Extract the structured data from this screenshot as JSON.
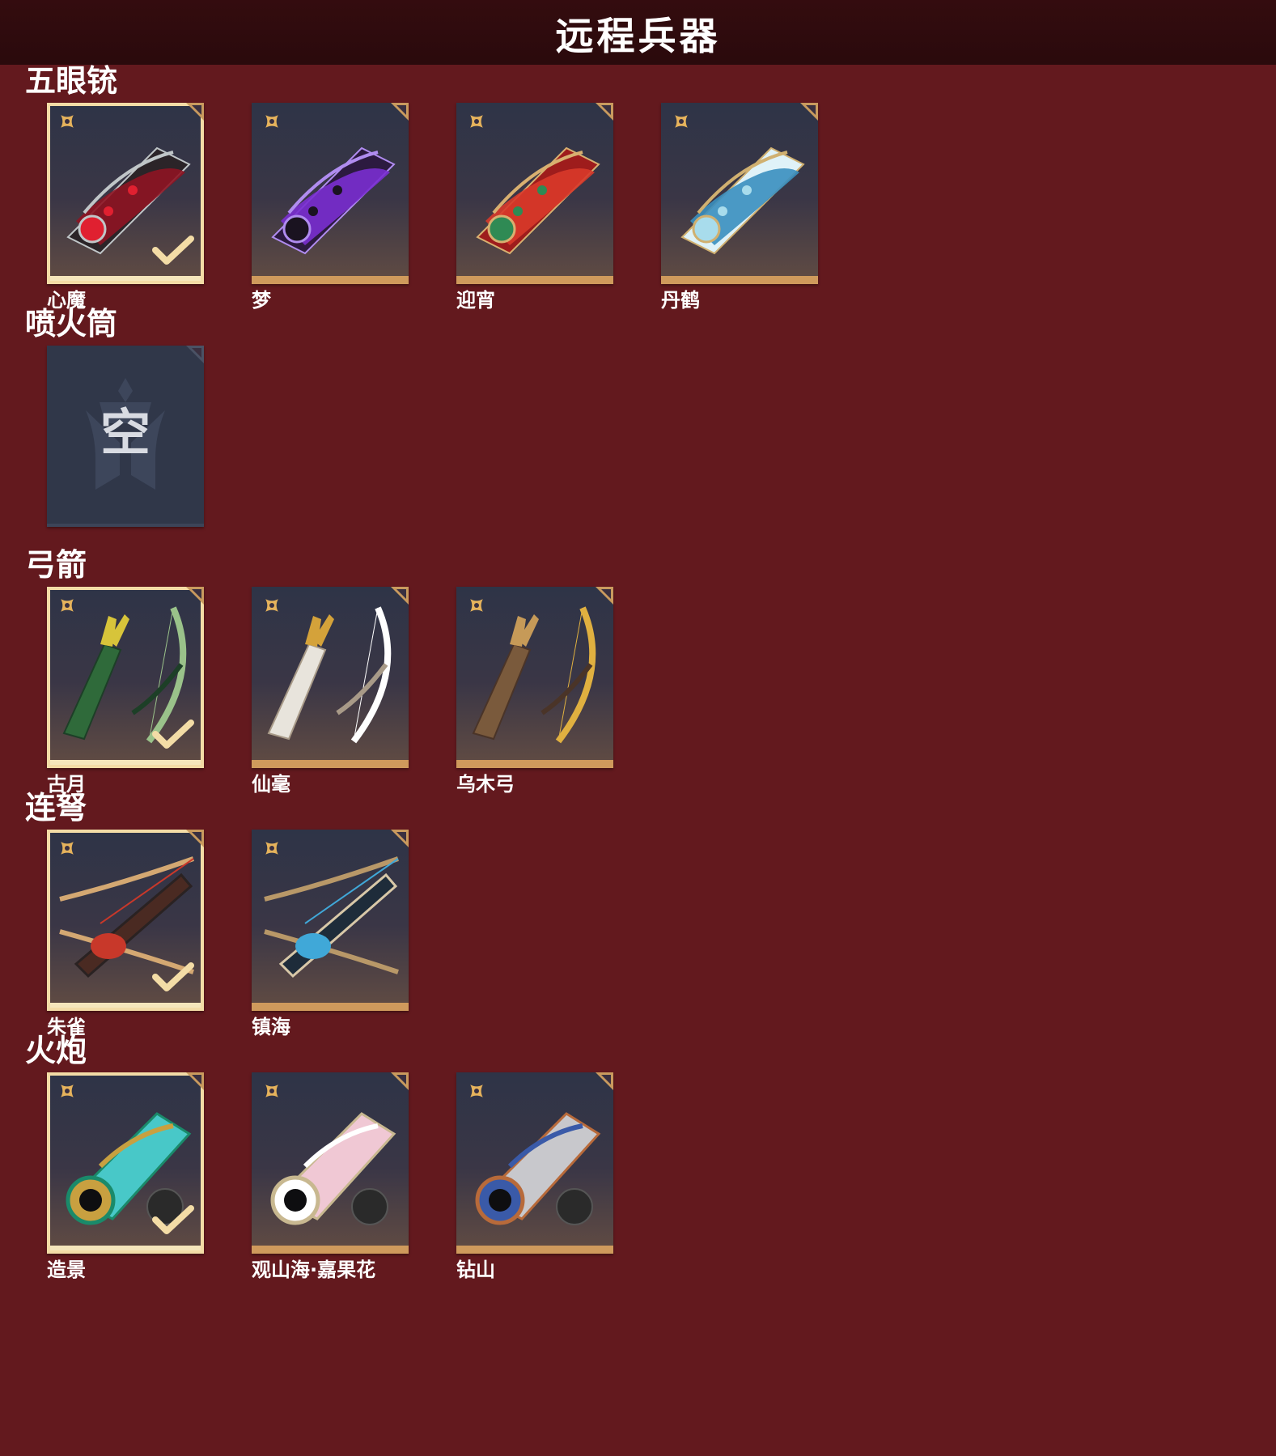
{
  "header": {
    "title": "远程兵器"
  },
  "sections": [
    {
      "heading": "五眼铳",
      "items": [
        {
          "label": "心魔",
          "selected": true,
          "theme": "crimson"
        },
        {
          "label": "梦",
          "selected": false,
          "theme": "violet"
        },
        {
          "label": "迎宵",
          "selected": false,
          "theme": "red"
        },
        {
          "label": "丹鹤",
          "selected": false,
          "theme": "azure"
        }
      ]
    },
    {
      "heading": "喷火筒",
      "items": [
        {
          "label": "",
          "empty_text": "空",
          "empty": true
        }
      ]
    },
    {
      "heading": "弓箭",
      "items": [
        {
          "label": "古月",
          "selected": true,
          "theme": "jade"
        },
        {
          "label": "仙毫",
          "selected": false,
          "theme": "ivory"
        },
        {
          "label": "乌木弓",
          "selected": false,
          "theme": "wood"
        }
      ]
    },
    {
      "heading": "连弩",
      "items": [
        {
          "label": "朱雀",
          "selected": true,
          "theme": "crossbow-red"
        },
        {
          "label": "镇海",
          "selected": false,
          "theme": "crossbow-blue"
        }
      ]
    },
    {
      "heading": "火炮",
      "items": [
        {
          "label": "造景",
          "selected": true,
          "theme": "cannon-teal"
        },
        {
          "label": "观山海·嘉果花",
          "selected": false,
          "theme": "cannon-pink"
        },
        {
          "label": "钻山",
          "selected": false,
          "theme": "cannon-silver"
        }
      ]
    }
  ],
  "icons": {
    "rarity": "quatrefoil-star-icon",
    "selected": "checkmark-icon",
    "empty_emblem": "helmet-emblem-icon"
  },
  "colors": {
    "background": "#63191e",
    "header": "#2d0b0d",
    "card_accent": "#cf9a5c",
    "selected_outline": "#f3dca6",
    "empty_card": "#303749"
  }
}
